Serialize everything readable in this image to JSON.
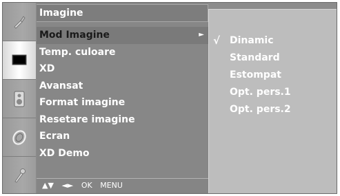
{
  "icons": [
    {
      "name": "picture-adjust-icon"
    },
    {
      "name": "screen-icon"
    },
    {
      "name": "audio-icon"
    },
    {
      "name": "clock-icon"
    },
    {
      "name": "option-icon"
    }
  ],
  "menu": {
    "title": "Imagine",
    "items": [
      {
        "label": "Mod Imagine"
      },
      {
        "label": "Temp. culoare"
      },
      {
        "label": "XD"
      },
      {
        "label": "Avansat"
      },
      {
        "label": "Format imagine"
      },
      {
        "label": "Resetare imagine"
      },
      {
        "label": "Ecran"
      },
      {
        "label": "XD Demo"
      }
    ],
    "selected_index": 0,
    "submenu_arrow": "►",
    "footer": {
      "nav_updown": "▲▼",
      "nav_leftright": "◄►",
      "ok": "OK",
      "menu": "MENU"
    }
  },
  "submenu": {
    "checkmark": "√",
    "items": [
      {
        "label": "Dinamic"
      },
      {
        "label": "Standard"
      },
      {
        "label": "Estompat"
      },
      {
        "label": "Opt. pers.1"
      },
      {
        "label": "Opt. pers.2"
      }
    ],
    "checked_index": 0
  }
}
